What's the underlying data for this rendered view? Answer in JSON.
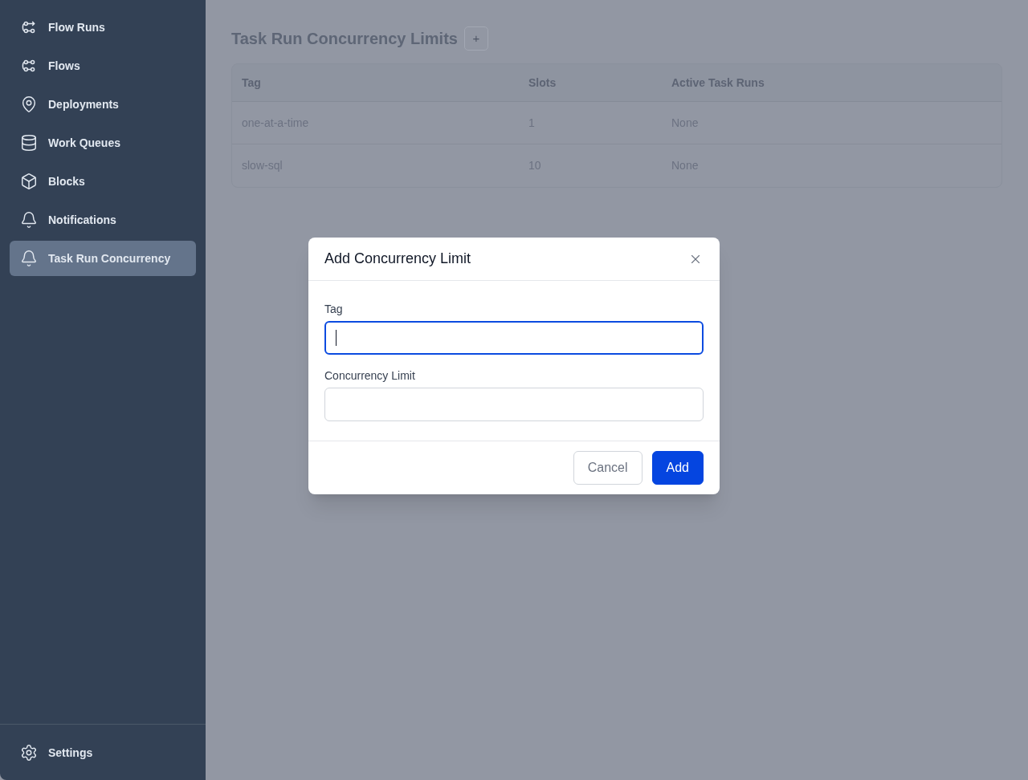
{
  "sidebar": {
    "items": [
      {
        "label": "Flow Runs",
        "selected": false
      },
      {
        "label": "Flows",
        "selected": false
      },
      {
        "label": "Deployments",
        "selected": false
      },
      {
        "label": "Work Queues",
        "selected": false
      },
      {
        "label": "Blocks",
        "selected": false
      },
      {
        "label": "Notifications",
        "selected": false
      },
      {
        "label": "Task Run Concurrency",
        "selected": true
      }
    ],
    "footer_items": [
      {
        "label": "Settings",
        "selected": false
      }
    ]
  },
  "page": {
    "title": "Task Run Concurrency Limits",
    "add_button": "+",
    "table": {
      "columns": [
        "Tag",
        "Slots",
        "Active Task Runs"
      ],
      "rows": [
        [
          "one-at-a-time",
          "1",
          "None"
        ],
        [
          "slow-sql",
          "10",
          "None"
        ]
      ]
    }
  },
  "dialog": {
    "title": "Add Concurrency Limit",
    "fields": [
      {
        "label": "Tag",
        "focused": true
      },
      {
        "label": "Concurrency Limit",
        "focused": false
      }
    ],
    "buttons": [
      {
        "label": "Cancel",
        "kind": "secondary"
      },
      {
        "label": "Add",
        "kind": "primary"
      }
    ]
  }
}
